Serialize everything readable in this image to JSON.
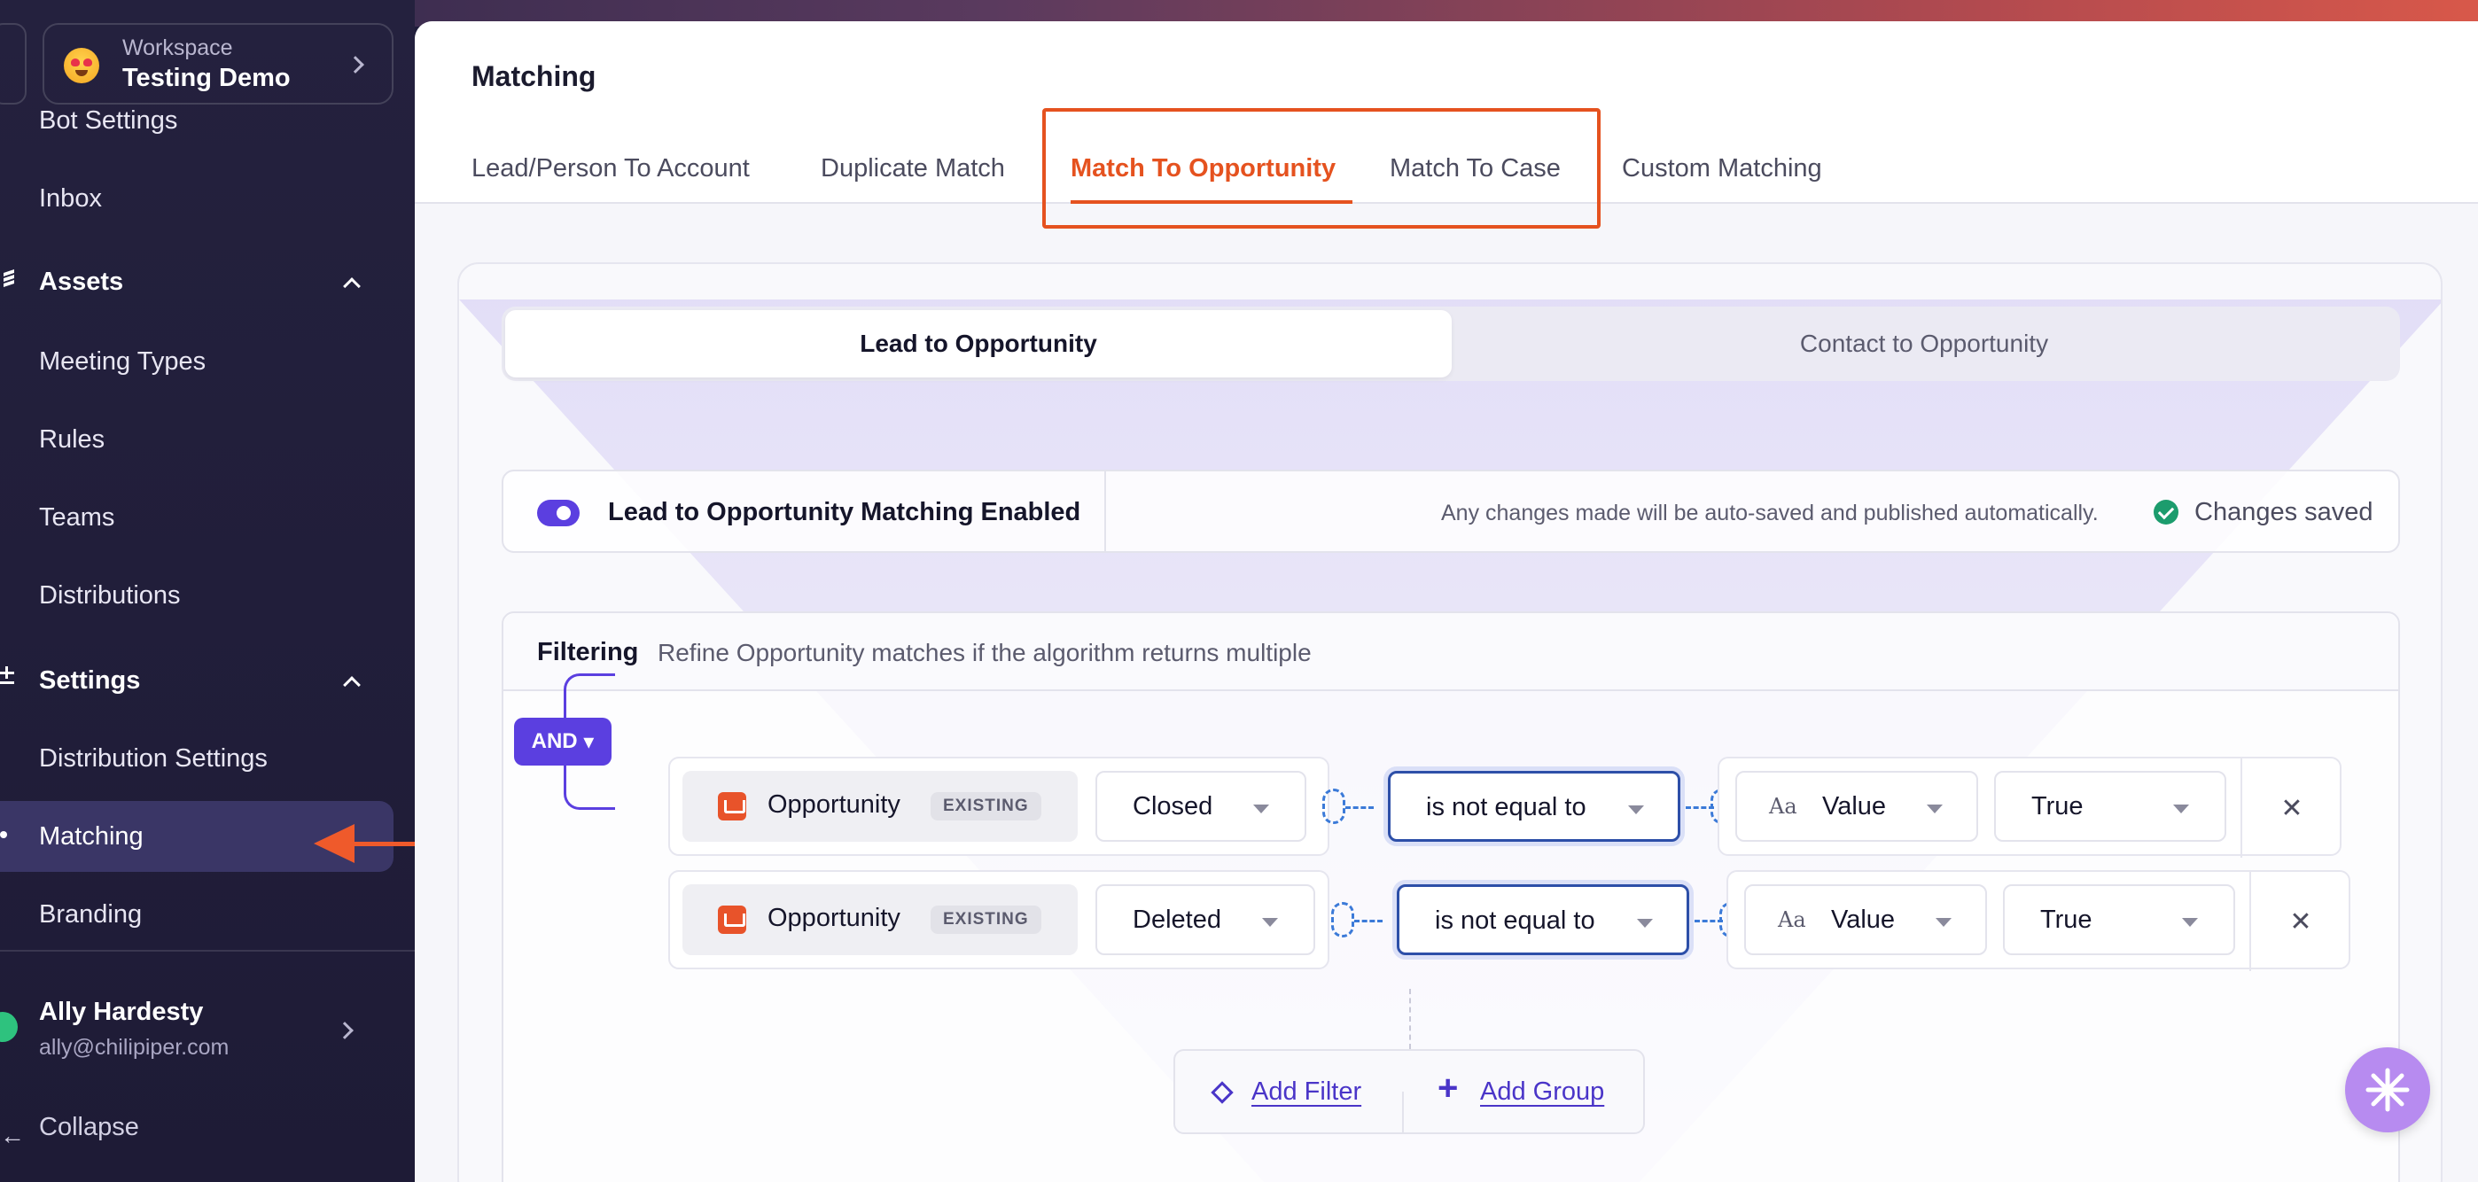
{
  "workspace": {
    "label": "Workspace",
    "name": "Testing Demo"
  },
  "sidebar": {
    "items_top": [
      "Bot Settings",
      "Inbox"
    ],
    "assets": {
      "title": "Assets",
      "items": [
        "Meeting Types",
        "Rules",
        "Teams",
        "Distributions"
      ]
    },
    "settings": {
      "title": "Settings",
      "items": [
        "Distribution Settings",
        "Matching",
        "Branding"
      ]
    },
    "active": "Matching",
    "user": {
      "name": "Ally Hardesty",
      "email": "ally@chilipiper.com"
    },
    "collapse": "Collapse"
  },
  "header": {
    "title": "Matching",
    "tabs": [
      "Lead/Person To Account",
      "Duplicate Match",
      "Match To Opportunity",
      "Match To Case",
      "Custom Matching"
    ],
    "active_tab": "Match To Opportunity"
  },
  "segment": {
    "active": "Lead to Opportunity",
    "inactive": "Contact to Opportunity"
  },
  "enable_bar": {
    "label": "Lead to Opportunity Matching Enabled",
    "autosave": "Any changes made will be auto-saved and published automatically.",
    "saved": "Changes saved"
  },
  "filtering": {
    "title": "Filtering",
    "subtitle": "Refine Opportunity matches if the algorithm returns multiple",
    "operator": "AND",
    "rows": [
      {
        "object": "Opportunity",
        "badge": "EXISTING",
        "field": "Closed",
        "condition": "is not equal to",
        "value_type": "Value",
        "value": "True"
      },
      {
        "object": "Opportunity",
        "badge": "EXISTING",
        "field": "Deleted",
        "condition": "is not equal to",
        "value_type": "Value",
        "value": "True"
      }
    ],
    "add_filter": "Add Filter",
    "add_group": "Add Group"
  },
  "colors": {
    "accent": "#e5521f",
    "primary": "#5b3fe0",
    "sidebar": "#24213e"
  }
}
